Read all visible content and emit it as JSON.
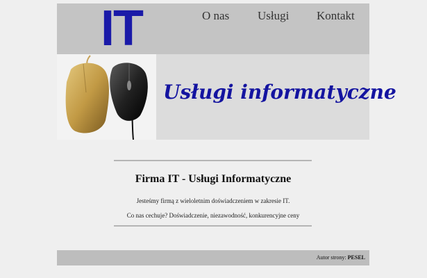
{
  "header": {
    "logo": "IT",
    "nav": [
      {
        "label": "O nas"
      },
      {
        "label": "Usługi"
      },
      {
        "label": "Kontakt"
      }
    ]
  },
  "banner": {
    "title": "Usługi informatyczne",
    "image_icon": "computer-mice-photo",
    "colors": {
      "title": "#1414a0",
      "logo": "#1a1aa8"
    }
  },
  "main": {
    "heading": "Firma IT - Usługi Informatyczne",
    "paragraphs": [
      "Jesteśmy firmą z wieloletnim doświadczeniem w zakresie IT.",
      "Co nas cechuje? Doświadczenie, niezawodność, konkurencyjne ceny"
    ]
  },
  "footer": {
    "author_label": "Autor strony:",
    "author_name": "PESEL"
  }
}
